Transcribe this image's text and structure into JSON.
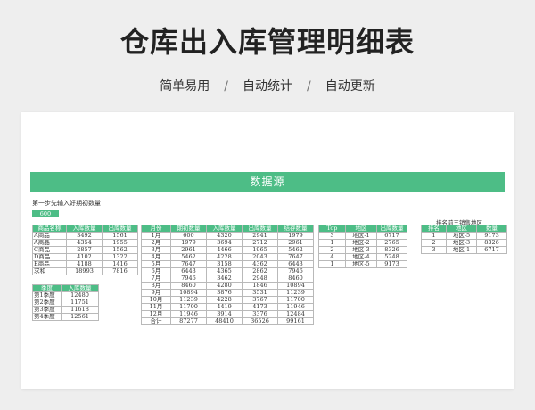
{
  "header": {
    "title": "仓库出入库管理明细表",
    "features": [
      "简单易用",
      "自动统计",
      "自动更新"
    ],
    "separator": "/"
  },
  "sheet": {
    "banner": "数据源",
    "note": "第一步先输入好期初数量",
    "initial_value": "600",
    "rank_title": "排名前三销售地区"
  },
  "colors": {
    "accent": "#4dbd86",
    "background": "#eeeeee",
    "grid": "#b9b9b9"
  },
  "tables": {
    "products": {
      "headers": [
        "商品名称",
        "入库数量",
        "出库数量"
      ],
      "rows": [
        [
          "A商品",
          "3492",
          "1561"
        ],
        [
          "A商品",
          "4354",
          "1955"
        ],
        [
          "C商品",
          "2857",
          "1562"
        ],
        [
          "D商品",
          "4102",
          "1322"
        ],
        [
          "E商品",
          "4188",
          "1416"
        ],
        [
          "求和",
          "18993",
          "7816"
        ]
      ]
    },
    "quarters": {
      "headers": [
        "季度",
        "入库数量"
      ],
      "rows": [
        [
          "第1季度",
          "12480"
        ],
        [
          "第2季度",
          "11751"
        ],
        [
          "第3季度",
          "11618"
        ],
        [
          "第4季度",
          "12561"
        ]
      ]
    },
    "monthly": {
      "headers": [
        "月份",
        "期初数量",
        "入库数量",
        "出库数量",
        "结存数量"
      ],
      "rows": [
        [
          "1月",
          "600",
          "4320",
          "2941",
          "1979"
        ],
        [
          "2月",
          "1979",
          "3694",
          "2712",
          "2961"
        ],
        [
          "3月",
          "2961",
          "4466",
          "1965",
          "5462"
        ],
        [
          "4月",
          "5462",
          "4228",
          "2043",
          "7647"
        ],
        [
          "5月",
          "7647",
          "3158",
          "4362",
          "6443"
        ],
        [
          "6月",
          "6443",
          "4365",
          "2862",
          "7946"
        ],
        [
          "7月",
          "7946",
          "3462",
          "2948",
          "8460"
        ],
        [
          "8月",
          "8460",
          "4280",
          "1846",
          "10894"
        ],
        [
          "9月",
          "10894",
          "3876",
          "3531",
          "11239"
        ],
        [
          "10月",
          "11239",
          "4228",
          "3767",
          "11700"
        ],
        [
          "11月",
          "11700",
          "4419",
          "4173",
          "11946"
        ],
        [
          "12月",
          "11946",
          "3914",
          "3376",
          "12484"
        ],
        [
          "合计",
          "87277",
          "48410",
          "36526",
          "99161"
        ]
      ]
    },
    "regions": {
      "headers": [
        "Top",
        "地区",
        "出库数量"
      ],
      "rows": [
        [
          "3",
          "地区-1",
          "6717"
        ],
        [
          "1",
          "地区-2",
          "2765"
        ],
        [
          "2",
          "地区-3",
          "8326"
        ],
        [
          "4",
          "地区-4",
          "5248"
        ],
        [
          "1",
          "地区-5",
          "9173"
        ]
      ]
    },
    "ranking": {
      "headers": [
        "排名",
        "地区",
        "数量"
      ],
      "rows": [
        [
          "1",
          "地区-5",
          "9173"
        ],
        [
          "2",
          "地区-3",
          "8326"
        ],
        [
          "3",
          "地区-1",
          "6717"
        ]
      ]
    }
  }
}
